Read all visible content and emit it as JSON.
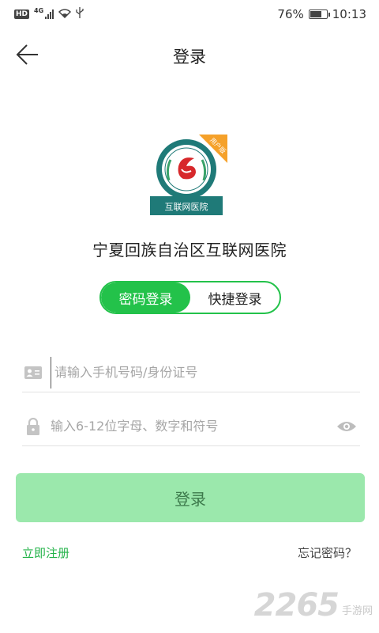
{
  "status_bar": {
    "hd": "HD",
    "network": "4G",
    "battery_percent": "76%",
    "battery_level": 0.76,
    "time": "10:13"
  },
  "header": {
    "title": "登录",
    "back_icon": "arrow-left-icon"
  },
  "logo": {
    "badge": "用户版",
    "caption": "互联网医院"
  },
  "hospital_name": "宁夏回族自治区互联网医院",
  "tabs": [
    {
      "label": "密码登录",
      "active": true
    },
    {
      "label": "快捷登录",
      "active": false
    }
  ],
  "form": {
    "account_placeholder": "请输入手机号码/身份证号",
    "account_value": "",
    "password_placeholder": "输入6-12位字母、数字和符号",
    "password_value": "",
    "account_icon": "id-card-icon",
    "password_icon": "lock-icon",
    "eye_icon": "eye-icon"
  },
  "login_button": "登录",
  "links": {
    "register": "立即注册",
    "forgot": "忘记密码？"
  },
  "watermark": {
    "number": "2265",
    "text": "手游网"
  },
  "colors": {
    "accent": "#23c24a",
    "button_disabled": "#9be8ac",
    "register_link": "#23b349"
  }
}
